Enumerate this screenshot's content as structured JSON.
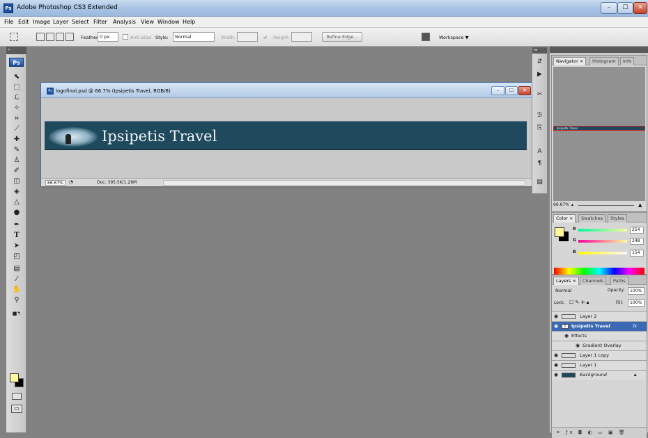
{
  "window": {
    "title": "Adobe Photoshop CS3 Extended",
    "min": "–",
    "max": "☐",
    "close": "✕"
  },
  "menu": [
    "File",
    "Edit",
    "Image",
    "Layer",
    "Select",
    "Filter",
    "Analysis",
    "View",
    "Window",
    "Help"
  ],
  "options": {
    "feather_label": "Feather:",
    "feather_value": "0 px",
    "antialias_label": "Anti-alias",
    "style_label": "Style:",
    "style_value": "Normal",
    "width_label": "Width:",
    "height_label": "Height:",
    "refine_edge": "Refine Edge...",
    "workspace": "Workspace ▼"
  },
  "tools": {
    "logo": "Ps"
  },
  "document": {
    "title": "logofinal.psd @ 66.7% (Ipsipetis Travel, RGB/8)",
    "banner_text": "Ipsipetis Travel",
    "zoom": "66.67%",
    "doc_info": "Doc: 395.5K/1.29M"
  },
  "navigator": {
    "tabs": [
      "Navigator ×",
      "Histogram",
      "Info"
    ],
    "zoom": "66.67%",
    "thumb_text": "Ipsipetis Travel"
  },
  "color": {
    "tabs": [
      "Color ×",
      "Swatches",
      "Styles"
    ],
    "r_label": "R",
    "g_label": "G",
    "b_label": "B",
    "r": "254",
    "g": "248",
    "b": "154",
    "foreground": "#fef89a",
    "background": "#000000"
  },
  "layers": {
    "tabs": [
      "Layers ×",
      "Channels",
      "Paths"
    ],
    "blend_mode": "Normal",
    "opacity_label": "Opacity:",
    "opacity": "100%",
    "lock_label": "Lock:",
    "fill_label": "Fill:",
    "fill": "100%",
    "rows": [
      {
        "name": "Layer 2"
      },
      {
        "name": "Ipsipetis Travel",
        "badge": "fx"
      },
      {
        "name": "Effects"
      },
      {
        "name": "Gradient Overlay"
      },
      {
        "name": "Layer 1 copy"
      },
      {
        "name": "Layer 1"
      },
      {
        "name": "Background"
      }
    ]
  }
}
